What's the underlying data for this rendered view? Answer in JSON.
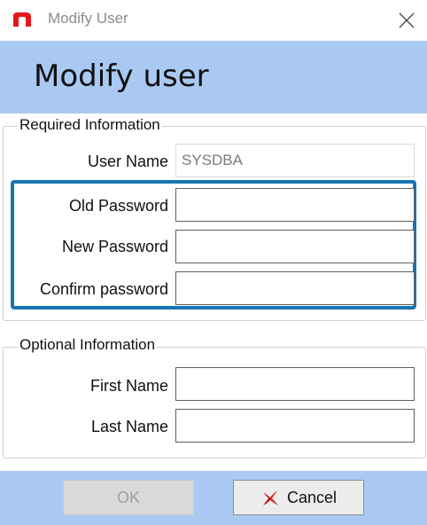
{
  "window": {
    "title": "Modify User",
    "close_icon": "close-icon",
    "logo_icon": "app-logo-icon",
    "logo_color": "#e3171c"
  },
  "header": {
    "title": "Modify user",
    "band_color": "#a9c9f3"
  },
  "required": {
    "legend": "Required Information",
    "user_name_label": "User Name",
    "user_name_value": "SYSDBA",
    "old_password_label": "Old Password",
    "old_password_value": "",
    "new_password_label": "New Password",
    "new_password_value": "",
    "confirm_password_label": "Confirm password",
    "confirm_password_value": "",
    "highlight_color": "#1a73b5"
  },
  "optional": {
    "legend": "Optional Information",
    "first_name_label": "First Name",
    "first_name_value": "",
    "last_name_label": "Last Name",
    "last_name_value": ""
  },
  "footer": {
    "ok_label": "OK",
    "ok_enabled": false,
    "cancel_label": "Cancel",
    "cancel_icon": "red-x-icon"
  }
}
